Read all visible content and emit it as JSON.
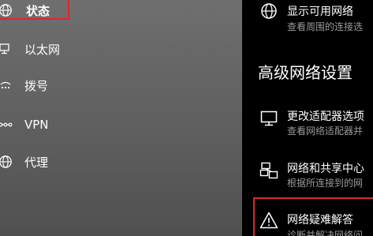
{
  "sidebar": {
    "items": [
      {
        "label": "状态",
        "icon": "globe-icon",
        "selected": true
      },
      {
        "label": "以太网",
        "icon": "ethernet-icon"
      },
      {
        "label": "拨号",
        "icon": "dialup-icon"
      },
      {
        "label": "VPN",
        "icon": "vpn-icon"
      },
      {
        "label": "代理",
        "icon": "globe-icon"
      }
    ]
  },
  "content": {
    "top_item": {
      "title": "显示可用网络",
      "subtitle": "查看周围的连接选",
      "icon": "globe-icon"
    },
    "section_heading": "高级网络设置",
    "items": [
      {
        "title": "更改适配器选项",
        "subtitle": "查看网络适配器并",
        "icon": "monitor-icon"
      },
      {
        "title": "网络和共享中心",
        "subtitle": "根据所连接到的网",
        "icon": "network-sharing-icon"
      },
      {
        "title": "网络疑难解答",
        "subtitle": "诊断并解决网络问",
        "icon": "warning-icon"
      }
    ]
  },
  "colors": {
    "highlight": "#e0242b",
    "content_bg": "#000000",
    "subtitle": "#9a9a9a"
  }
}
